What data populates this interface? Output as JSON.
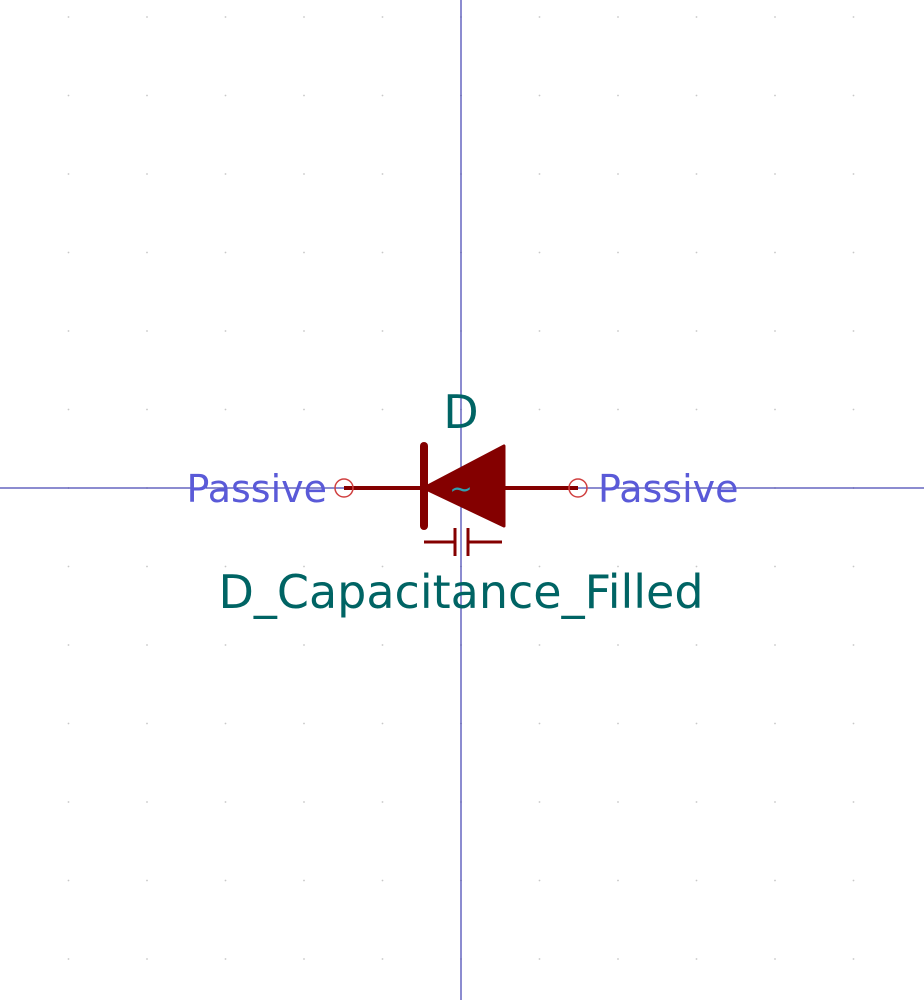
{
  "symbol": {
    "reference": "D",
    "value": "D_Capacitance_Filled",
    "body_glyph": "~"
  },
  "pins": [
    {
      "side": "left",
      "electrical_type": "Passive"
    },
    {
      "side": "right",
      "electrical_type": "Passive"
    }
  ],
  "colors": {
    "background": "#ffffff",
    "grid_dot": "#c8c8c8",
    "axis": "#1a1aa0",
    "body": "#840000",
    "field_text": "#006464",
    "pin_type_text": "#5a5ad8",
    "pin_marker": "#d04040",
    "body_glyph": "#30a0b0"
  }
}
